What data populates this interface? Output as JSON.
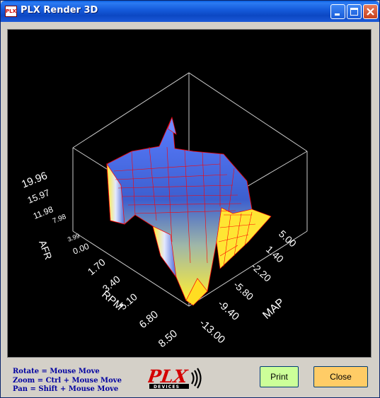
{
  "window": {
    "title": "PLX Render 3D",
    "icon_text": "PLX",
    "controls": [
      "minimize-icon",
      "maximize-icon",
      "close-icon"
    ]
  },
  "plot": {
    "afr_label": "AFR",
    "afr_ticks": [
      "19.96",
      "15.97",
      "11.98",
      "7.98",
      "3.99",
      "0.00"
    ],
    "rpm_label": "RPM",
    "rpm_ticks": [
      "1.70",
      "3.40",
      "5.10",
      "6.80",
      "8.50"
    ],
    "map_label": "MAP",
    "map_ticks": [
      "5.00",
      "1.40",
      "-2.20",
      "-5.80",
      "-9.40",
      "-13.00"
    ],
    "colors": {
      "background": "#000000",
      "box": "#cccccc",
      "mesh": "#ff0000",
      "surface_low": "#ffee33",
      "surface_high": "#3b5fd1"
    }
  },
  "help": {
    "line1": "Rotate = Mouse Move",
    "line2": "Zoom = Ctrl + Mouse Move",
    "line3": "Pan = Shift + Mouse Move"
  },
  "logo": {
    "text": "PLX",
    "sub": "DEVICES"
  },
  "buttons": {
    "print": "Print",
    "close": "Close"
  }
}
